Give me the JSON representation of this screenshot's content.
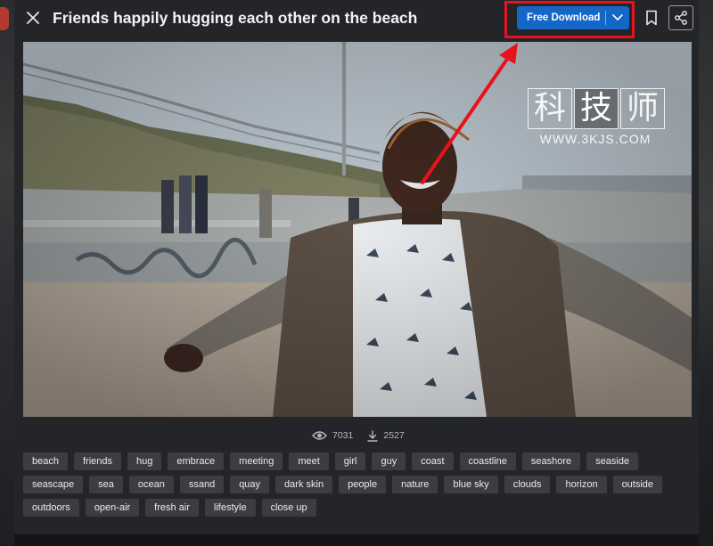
{
  "header": {
    "title": "Friends happily hugging each other on the beach",
    "download_label": "Free Download",
    "close_icon": "close-icon",
    "caret_icon": "chevron-down-icon",
    "bookmark_icon": "bookmark-icon",
    "share_icon": "share-icon"
  },
  "watermark": {
    "chars": [
      "科",
      "技",
      "师"
    ],
    "url": "WWW.3KJS.COM"
  },
  "stats": {
    "views": "7031",
    "downloads": "2527",
    "views_icon": "eye-icon",
    "downloads_icon": "download-icon"
  },
  "tags": [
    "beach",
    "friends",
    "hug",
    "embrace",
    "meeting",
    "meet",
    "girl",
    "guy",
    "coast",
    "coastline",
    "seashore",
    "seaside",
    "seascape",
    "sea",
    "ocean",
    "ssand",
    "quay",
    "dark skin",
    "people",
    "nature",
    "blue sky",
    "clouds",
    "horizon",
    "outside",
    "outdoors",
    "open-air",
    "fresh air",
    "lifestyle",
    "close up"
  ],
  "colors": {
    "accent": "#1466c7",
    "highlight": "#e8121c",
    "tag_bg": "#3b3d42",
    "modal_bg": "#242529"
  }
}
